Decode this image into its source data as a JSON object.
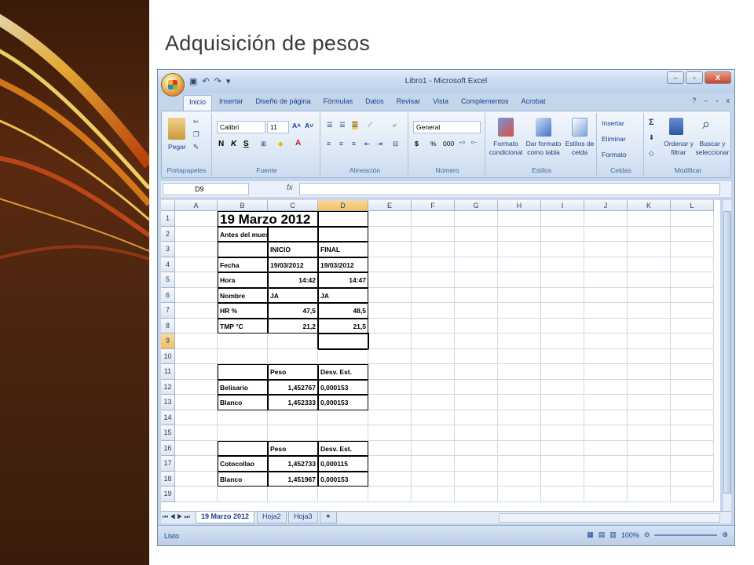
{
  "slide": {
    "title": "Adquisición de pesos"
  },
  "window": {
    "title": "Libro1 - Microsoft Excel",
    "controls": {
      "minimize": "–",
      "maximize": "▫",
      "close": "X"
    }
  },
  "ribbon_tabs": [
    "Inicio",
    "Insertar",
    "Diseño de página",
    "Fórmulas",
    "Datos",
    "Revisar",
    "Vista",
    "Complementos",
    "Acrobat"
  ],
  "ribbon": {
    "portapapeles": {
      "label": "Portapapeles",
      "paste": "Pegar"
    },
    "fuente": {
      "label": "Fuente",
      "font_name": "Calibri",
      "font_size": "11",
      "bold": "N",
      "italic": "K",
      "underline": "S"
    },
    "alineacion": {
      "label": "Alineación"
    },
    "numero": {
      "label": "Número",
      "format": "General",
      "percent": "%",
      "thousands": "000"
    },
    "estilos": {
      "label": "Estilos",
      "cond": "Formato condicional",
      "table": "Dar formato como tabla",
      "cell": "Estilos de celda"
    },
    "celdas": {
      "label": "Celdas",
      "insert": "Insertar",
      "delete": "Eliminar",
      "format": "Formato"
    },
    "modificar": {
      "label": "Modificar",
      "sort": "Ordenar y filtrar",
      "find": "Buscar y seleccionar"
    }
  },
  "formula_bar": {
    "name_box": "D9",
    "fx": "fx",
    "value": ""
  },
  "columns": [
    "A",
    "B",
    "C",
    "D",
    "E",
    "F",
    "G",
    "H",
    "I",
    "J",
    "K",
    "L"
  ],
  "rows": [
    "1",
    "2",
    "3",
    "4",
    "5",
    "6",
    "7",
    "8",
    "9",
    "10",
    "11",
    "12",
    "13",
    "14",
    "15",
    "16",
    "17",
    "18",
    "19"
  ],
  "cells": {
    "B1": "19 Marzo 2012",
    "B2": "Antes del muestreo",
    "C3": "INICIO",
    "D3": "FINAL",
    "B4": "Fecha",
    "C4": "19/03/2012",
    "D4": "19/03/2012",
    "B5": "Hora",
    "C5": "14:42",
    "D5": "14:47",
    "B6": "Nombre",
    "C6": "JA",
    "D6": "JA",
    "B7": "HR %",
    "C7": "47,5",
    "D7": "48,5",
    "B8": "TMP °C",
    "C8": "21,2",
    "D8": "21,5",
    "C11": "Peso",
    "D11": "Desv. Est.",
    "B12": "Belisario",
    "C12": "1,452767",
    "D12": "0,000153",
    "B13": "Blanco",
    "C13": "1,452333",
    "D13": "0,000153",
    "C16": "Peso",
    "D16": "Desv. Est.",
    "B17": "Cotocollao",
    "C17": "1,452733",
    "D17": "0,000115",
    "B18": "Blanco",
    "C18": "1,451967",
    "D18": "0,000153"
  },
  "sheets": [
    "19 Marzo 2012",
    "Hoja2",
    "Hoja3"
  ],
  "status": {
    "text": "Listo",
    "zoom": "100%"
  }
}
